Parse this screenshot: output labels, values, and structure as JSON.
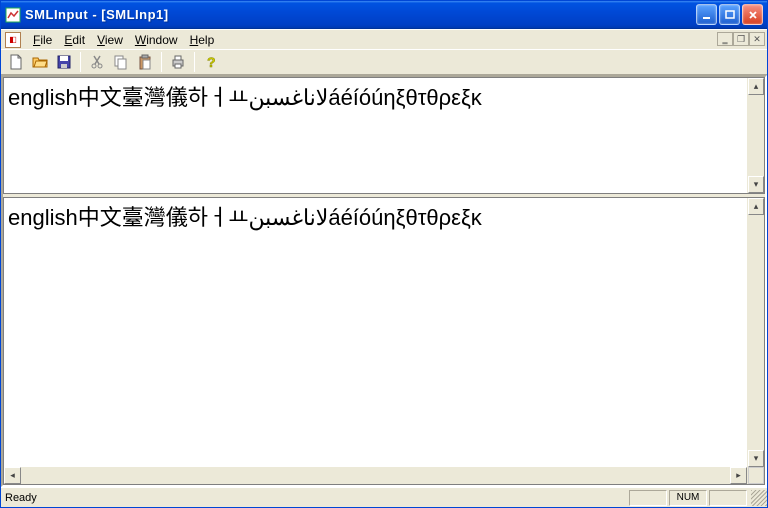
{
  "titlebar": {
    "title": "SMLInput - [SMLInp1]"
  },
  "menubar": {
    "file": "File",
    "edit": "Edit",
    "view": "View",
    "window": "Window",
    "help": "Help"
  },
  "toolbar": {
    "new": "New",
    "open": "Open",
    "save": "Save",
    "cut": "Cut",
    "copy": "Copy",
    "paste": "Paste",
    "print": "Print",
    "help": "Help"
  },
  "panes": {
    "top_text": "english中文臺灣儀하ㅓㅛلاناغسبنáéíóúηξθτθρεξκ",
    "bottom_text": "english中文臺灣儀하ㅓㅛلاناغسبنáéíóúηξθτθρεξκ"
  },
  "statusbar": {
    "ready": "Ready",
    "num": "NUM"
  }
}
